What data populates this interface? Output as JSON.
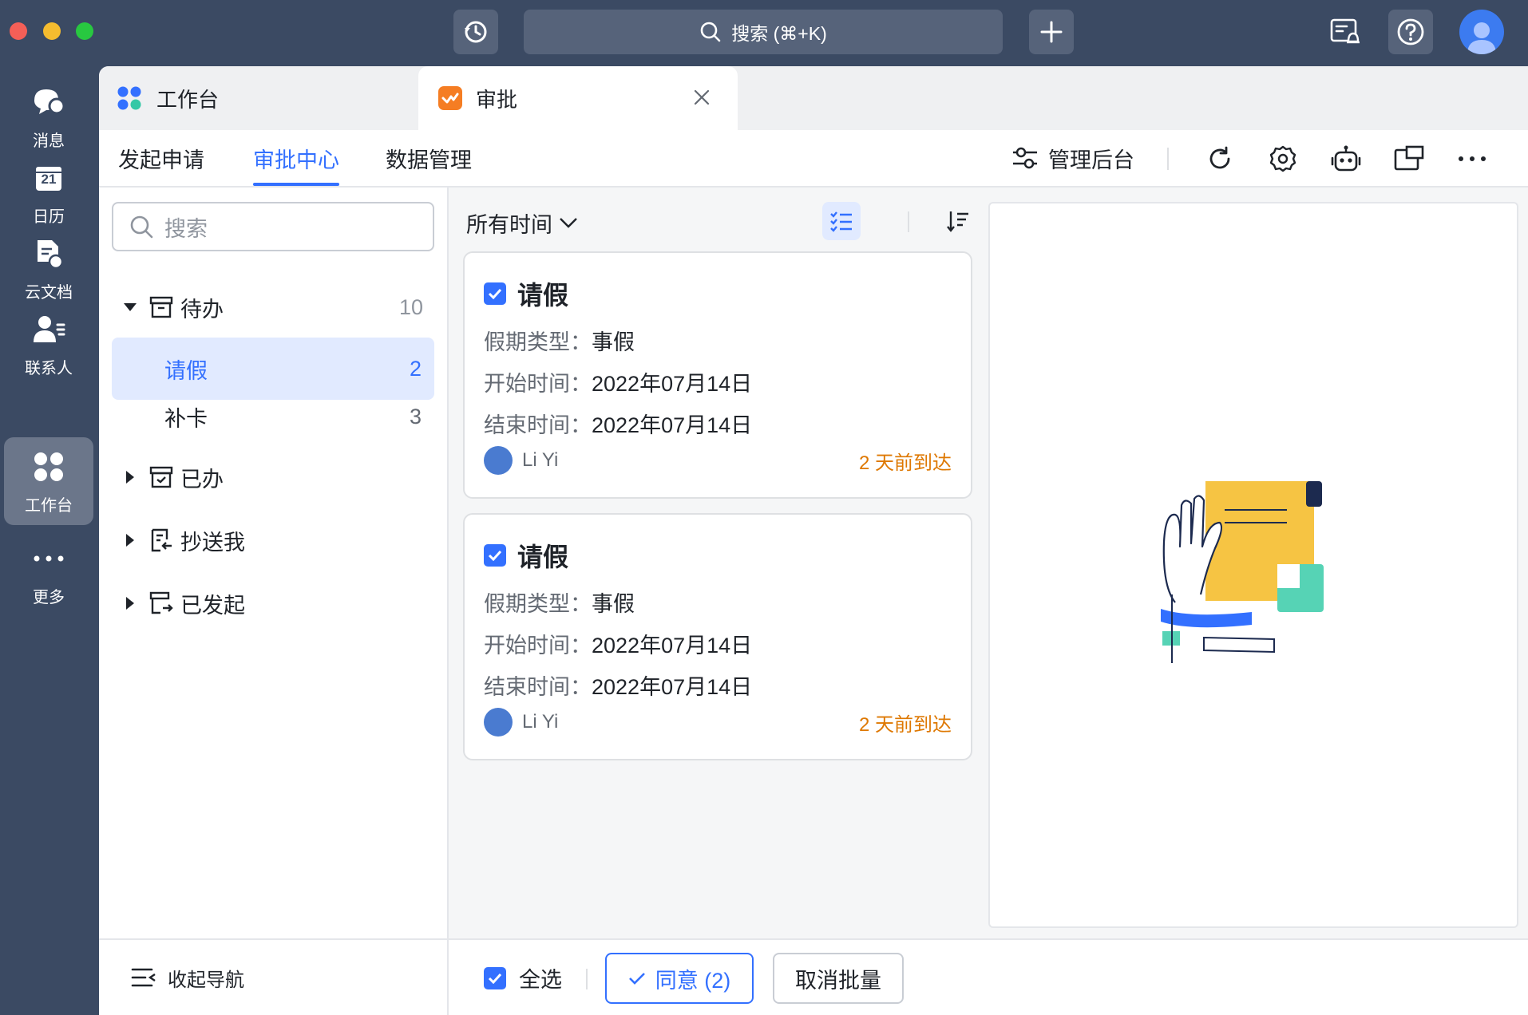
{
  "titlebar": {
    "search_label": "搜索 (⌘+K)"
  },
  "leftnav": {
    "items": [
      {
        "label": "消息",
        "icon": "chat-icon"
      },
      {
        "label": "日历",
        "icon": "calendar-icon",
        "badge": "21"
      },
      {
        "label": "云文档",
        "icon": "docs-icon"
      },
      {
        "label": "联系人",
        "icon": "contacts-icon"
      },
      {
        "label": "工作台",
        "icon": "workplace-icon",
        "active": true
      },
      {
        "label": "更多",
        "icon": "more-icon"
      }
    ]
  },
  "apptabs": {
    "workplace": "工作台",
    "approval": "审批"
  },
  "subnav": {
    "tabs": [
      "发起申请",
      "审批中心",
      "数据管理"
    ],
    "active_tab": "审批中心",
    "admin": "管理后台"
  },
  "sidebar": {
    "search_placeholder": "搜索",
    "todo": {
      "label": "待办",
      "count": "10"
    },
    "todo_items": [
      {
        "label": "请假",
        "count": "2"
      },
      {
        "label": "补卡",
        "count": "3"
      }
    ],
    "done": "已办",
    "cc": "抄送我",
    "initiated": "已发起",
    "collapse": "收起导航"
  },
  "list": {
    "filter": "所有时间",
    "cards": [
      {
        "title": "请假",
        "type_key": "假期类型：",
        "type_val": "事假",
        "start_key": "开始时间：",
        "start_val": "2022年07月14日",
        "end_key": "结束时间：",
        "end_val": "2022年07月14日",
        "user": "Li Yi",
        "arrived": "2 天前到达"
      },
      {
        "title": "请假",
        "type_key": "假期类型：",
        "type_val": "事假",
        "start_key": "开始时间：",
        "start_val": "2022年07月14日",
        "end_key": "结束时间：",
        "end_val": "2022年07月14日",
        "user": "Li Yi",
        "arrived": "2 天前到达"
      }
    ]
  },
  "bottombar": {
    "select_all": "全选",
    "agree": "同意 (2)",
    "cancel_batch": "取消批量"
  },
  "colors": {
    "accent": "#3370ff",
    "sidebar_bg": "#3b4a63",
    "warning": "#de7802"
  }
}
